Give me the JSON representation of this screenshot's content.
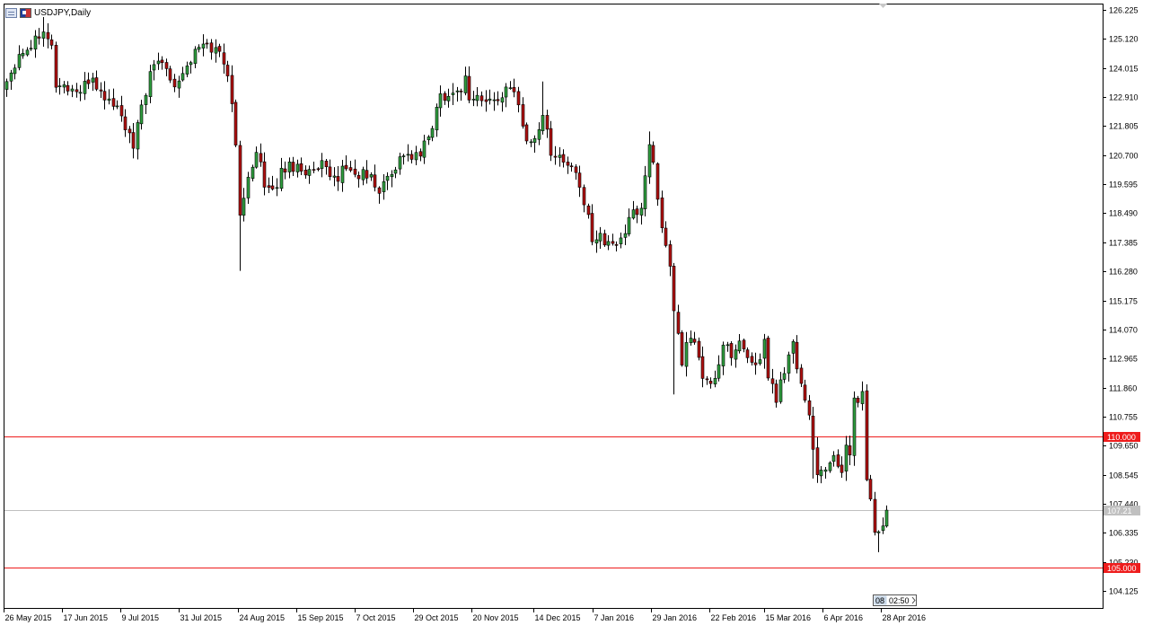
{
  "window": {
    "title": "USDJPY,Daily"
  },
  "icons": {
    "chart_window_icon": "chart-window-icon",
    "symbol_flag_icon": "symbol-flag-icon"
  },
  "colors": {
    "bull": "#2e9e3e",
    "bear": "#b01010",
    "wick": "#000000",
    "level_line": "#ee1c1c",
    "current_line": "#c0c0c0",
    "current_label": "#c0c0c0"
  },
  "price_axis": {
    "ticks": [
      "126.225",
      "125.120",
      "124.015",
      "122.910",
      "121.805",
      "120.700",
      "119.595",
      "118.490",
      "117.385",
      "116.280",
      "115.175",
      "114.070",
      "112.965",
      "111.860",
      "110.755",
      "109.650",
      "108.545",
      "107.440",
      "106.335",
      "105.230",
      "104.125"
    ]
  },
  "time_axis": {
    "labels": [
      "26 May 2015",
      "17 Jun 2015",
      "9 Jul 2015",
      "31 Jul 2015",
      "24 Aug 2015",
      "15 Sep 2015",
      "7 Oct 2015",
      "29 Oct 2015",
      "20 Nov 2015",
      "14 Dec 2015",
      "7 Jan 2016",
      "29 Jan 2016",
      "22 Feb 2016",
      "15 Mar 2016",
      "6 Apr 2016",
      "28 Apr 2016"
    ]
  },
  "countdown": {
    "hours": "08",
    "rest": "02:50"
  },
  "chart_data": {
    "type": "candlestick",
    "title": "USDJPY,Daily",
    "ylim": [
      103.48,
      126.43
    ],
    "current_price": 107.21,
    "current_price_label": "107.21",
    "levels": [
      {
        "price": 110.0,
        "label": "110.000"
      },
      {
        "price": 105.0,
        "label": "105.000"
      }
    ],
    "date_labels": [
      "26 May 2015",
      "17 Jun 2015",
      "9 Jul 2015",
      "31 Jul 2015",
      "24 Aug 2015",
      "15 Sep 2015",
      "7 Oct 2015",
      "29 Oct 2015",
      "20 Nov 2015",
      "14 Dec 2015",
      "7 Jan 2016",
      "29 Jan 2016",
      "22 Feb 2016",
      "15 Mar 2016",
      "6 Apr 2016",
      "28 Apr 2016"
    ],
    "anchors": [
      [
        0,
        123.5
      ],
      [
        3,
        124.6
      ],
      [
        6,
        124.9
      ],
      [
        9,
        125.6
      ],
      [
        11,
        124.8
      ],
      [
        12,
        123.4
      ],
      [
        14,
        123.3
      ],
      [
        16,
        123.2
      ],
      [
        18,
        123.1
      ],
      [
        21,
        123.7
      ],
      [
        23,
        123.0
      ],
      [
        25,
        122.8
      ],
      [
        27,
        122.5
      ],
      [
        29,
        121.8
      ],
      [
        31,
        120.9
      ],
      [
        33,
        122.6
      ],
      [
        35,
        123.7
      ],
      [
        37,
        124.3
      ],
      [
        39,
        124.1
      ],
      [
        41,
        123.4
      ],
      [
        44,
        124.1
      ],
      [
        46,
        124.6
      ],
      [
        48,
        124.9
      ],
      [
        50,
        124.8
      ],
      [
        52,
        124.6
      ],
      [
        54,
        123.9
      ],
      [
        55,
        122.5
      ],
      [
        56,
        121.0
      ],
      [
        57,
        118.6
      ],
      [
        58,
        118.9
      ],
      [
        59,
        119.8
      ],
      [
        61,
        121.0
      ],
      [
        62,
        120.4
      ],
      [
        63,
        119.4
      ],
      [
        65,
        119.2
      ],
      [
        67,
        120.1
      ],
      [
        69,
        120.3
      ],
      [
        71,
        120.3
      ],
      [
        73,
        120.1
      ],
      [
        75,
        120.0
      ],
      [
        77,
        120.3
      ],
      [
        79,
        119.8
      ],
      [
        81,
        119.9
      ],
      [
        83,
        120.3
      ],
      [
        85,
        119.9
      ],
      [
        87,
        120.0
      ],
      [
        89,
        119.8
      ],
      [
        91,
        119.3
      ],
      [
        93,
        119.9
      ],
      [
        95,
        120.3
      ],
      [
        97,
        120.8
      ],
      [
        99,
        120.6
      ],
      [
        101,
        120.7
      ],
      [
        103,
        121.4
      ],
      [
        105,
        122.4
      ],
      [
        106,
        123.0
      ],
      [
        108,
        123.0
      ],
      [
        110,
        123.1
      ],
      [
        111,
        123.3
      ],
      [
        112,
        123.6
      ],
      [
        113,
        122.9
      ],
      [
        115,
        122.9
      ],
      [
        117,
        122.7
      ],
      [
        119,
        122.8
      ],
      [
        121,
        123.0
      ],
      [
        123,
        123.2
      ],
      [
        125,
        122.8
      ],
      [
        126,
        121.9
      ],
      [
        127,
        121.2
      ],
      [
        129,
        121.3
      ],
      [
        131,
        122.3
      ],
      [
        132,
        121.5
      ],
      [
        133,
        120.9
      ],
      [
        135,
        120.6
      ],
      [
        137,
        120.3
      ],
      [
        138,
        120.3
      ],
      [
        140,
        119.4
      ],
      [
        142,
        118.3
      ],
      [
        143,
        117.6
      ],
      [
        145,
        117.7
      ],
      [
        147,
        117.2
      ],
      [
        149,
        117.4
      ],
      [
        151,
        117.8
      ],
      [
        153,
        118.5
      ],
      [
        155,
        118.7
      ],
      [
        157,
        121.1
      ],
      [
        158,
        120.5
      ],
      [
        159,
        119.2
      ],
      [
        160,
        117.8
      ],
      [
        162,
        116.3
      ],
      [
        163,
        114.8
      ],
      [
        165,
        112.8
      ],
      [
        166,
        113.4
      ],
      [
        167,
        113.9
      ],
      [
        169,
        113.0
      ],
      [
        170,
        112.2
      ],
      [
        172,
        111.9
      ],
      [
        174,
        112.7
      ],
      [
        175,
        113.7
      ],
      [
        176,
        113.3
      ],
      [
        177,
        112.9
      ],
      [
        179,
        113.5
      ],
      [
        181,
        113.1
      ],
      [
        183,
        112.7
      ],
      [
        185,
        113.5
      ],
      [
        186,
        112.4
      ],
      [
        188,
        111.5
      ],
      [
        189,
        112.1
      ],
      [
        190,
        112.5
      ],
      [
        191,
        113.3
      ],
      [
        192,
        113.6
      ],
      [
        193,
        112.6
      ],
      [
        195,
        111.5
      ],
      [
        196,
        110.8
      ],
      [
        197,
        109.5
      ],
      [
        198,
        108.7
      ],
      [
        199,
        108.5
      ],
      [
        200,
        108.6
      ],
      [
        201,
        108.9
      ],
      [
        202,
        109.4
      ],
      [
        203,
        108.8
      ],
      [
        204,
        108.7
      ],
      [
        205,
        109.6
      ],
      [
        206,
        109.3
      ],
      [
        207,
        111.5
      ],
      [
        208,
        111.2
      ],
      [
        209,
        111.6
      ],
      [
        210,
        108.4
      ],
      [
        211,
        107.5
      ],
      [
        212,
        106.2
      ],
      [
        213,
        106.3
      ],
      [
        214,
        106.7
      ],
      [
        215,
        107.2
      ]
    ]
  }
}
